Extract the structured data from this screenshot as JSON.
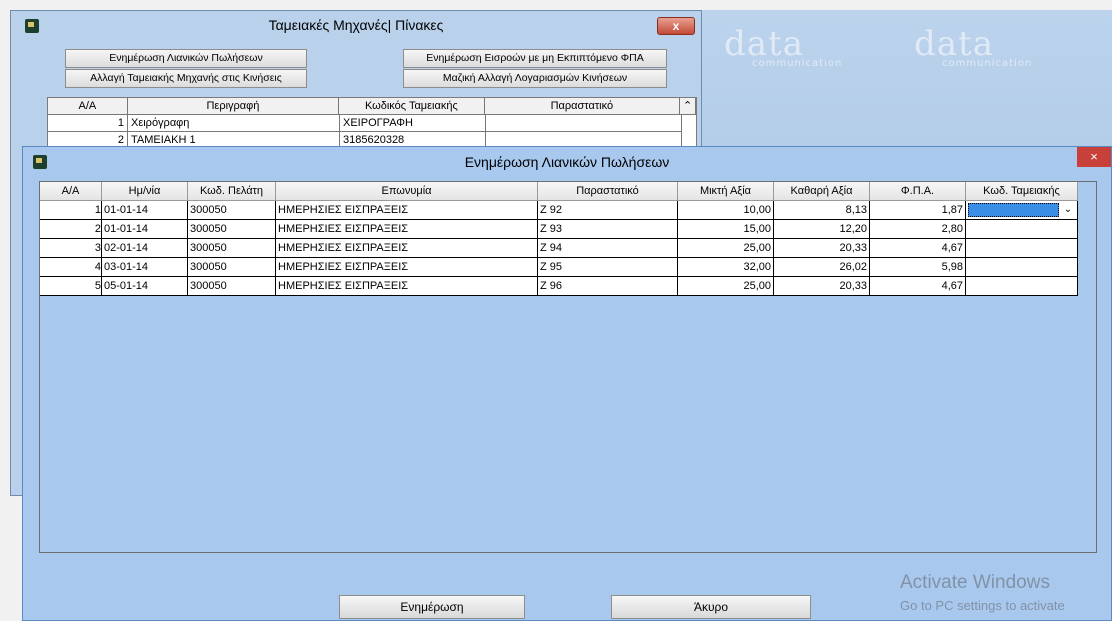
{
  "watermark": {
    "brand": "data",
    "tagline": "communication"
  },
  "back_window": {
    "title": "Ταμειακές Μηχανές| Πίνακες",
    "close_label": "x",
    "buttons": {
      "update_retail": "Ενημέρωση Λιανικών Πωλήσεων",
      "change_register": "Αλλαγή Ταμειακής Μηχανής στις Κινήσεις",
      "update_income": "Ενημέρωση Εισροών με μη Εκπιπτόμενο ΦΠΑ",
      "bulk_change": "Μαζική Αλλαγή Λογαριασμών Κινήσεων"
    },
    "grid": {
      "headers": [
        "Α/Α",
        "Περιγραφή",
        "Κωδικός Ταμειακής",
        "Παραστατικό"
      ],
      "rows": [
        {
          "aa": "1",
          "desc": "Χειρόγραφη",
          "code": "ΧΕΙΡΟΓΡΑΦΗ",
          "doc": ""
        },
        {
          "aa": "2",
          "desc": "ΤΑΜΕΙΑΚΗ 1",
          "code": "3185620328",
          "doc": ""
        }
      ]
    }
  },
  "dialog": {
    "title": "Ενημέρωση Λιανικών Πωλήσεων",
    "close_label": "×",
    "headers": [
      "Α/Α",
      "Ημ/νία",
      "Κωδ. Πελάτη",
      "Επωνυμία",
      "Παραστατικό",
      "Μικτή Αξία",
      "Καθαρή Αξία",
      "Φ.Π.Α.",
      "Κωδ. Ταμειακής"
    ],
    "rows": [
      {
        "aa": "1",
        "date": "01-01-14",
        "customer": "300050",
        "name": "ΗΜΕΡΗΣΙΕΣ ΕΙΣΠΡΑΞΕΙΣ",
        "doc": "Z 92",
        "gross": "10,00",
        "net": "8,13",
        "vat": "1,87",
        "register": ""
      },
      {
        "aa": "2",
        "date": "01-01-14",
        "customer": "300050",
        "name": "ΗΜΕΡΗΣΙΕΣ ΕΙΣΠΡΑΞΕΙΣ",
        "doc": "Z 93",
        "gross": "15,00",
        "net": "12,20",
        "vat": "2,80",
        "register": ""
      },
      {
        "aa": "3",
        "date": "02-01-14",
        "customer": "300050",
        "name": "ΗΜΕΡΗΣΙΕΣ ΕΙΣΠΡΑΞΕΙΣ",
        "doc": "Z 94",
        "gross": "25,00",
        "net": "20,33",
        "vat": "4,67",
        "register": ""
      },
      {
        "aa": "4",
        "date": "03-01-14",
        "customer": "300050",
        "name": "ΗΜΕΡΗΣΙΕΣ ΕΙΣΠΡΑΞΕΙΣ",
        "doc": "Z 95",
        "gross": "32,00",
        "net": "26,02",
        "vat": "5,98",
        "register": ""
      },
      {
        "aa": "5",
        "date": "05-01-14",
        "customer": "300050",
        "name": "ΗΜΕΡΗΣΙΕΣ ΕΙΣΠΡΑΞΕΙΣ",
        "doc": "Z 96",
        "gross": "25,00",
        "net": "20,33",
        "vat": "4,67",
        "register": ""
      }
    ],
    "dropdown_arrow": "⌄",
    "update_button": "Ενημέρωση",
    "cancel_button": "Άκυρο"
  },
  "activation": {
    "line1": "Activate Windows",
    "line2": "Go to PC settings to activate"
  }
}
